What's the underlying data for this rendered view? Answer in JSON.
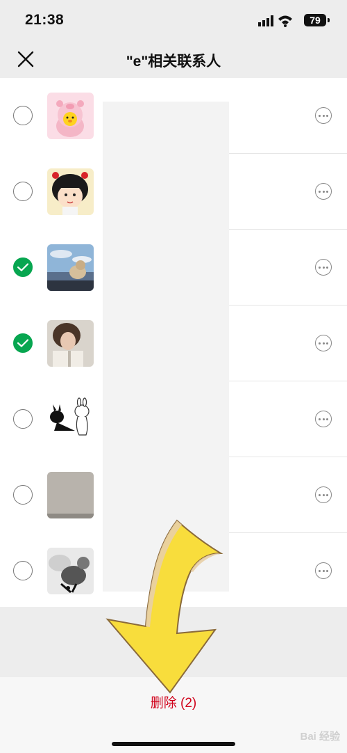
{
  "status_bar": {
    "time": "21:38",
    "battery": "79"
  },
  "nav": {
    "title": "\"e\"相关联系人",
    "close_icon": "close-icon"
  },
  "contacts": [
    {
      "checked": false,
      "avatar": "pig-costume-avatar"
    },
    {
      "checked": false,
      "avatar": "cartoon-girl-avatar"
    },
    {
      "checked": true,
      "avatar": "cat-in-car-avatar"
    },
    {
      "checked": true,
      "avatar": "woman-portrait-avatar"
    },
    {
      "checked": false,
      "avatar": "cartoon-rabbits-avatar"
    },
    {
      "checked": false,
      "avatar": "gray-square-avatar"
    },
    {
      "checked": false,
      "avatar": "cat-sketch-avatar"
    }
  ],
  "footer": {
    "delete_label": "删除 (2)"
  },
  "watermark": {
    "text": "Bai 经验"
  },
  "colors": {
    "accent_green": "#07a650",
    "danger_red": "#d0021b",
    "bar_gray": "#ededed"
  }
}
